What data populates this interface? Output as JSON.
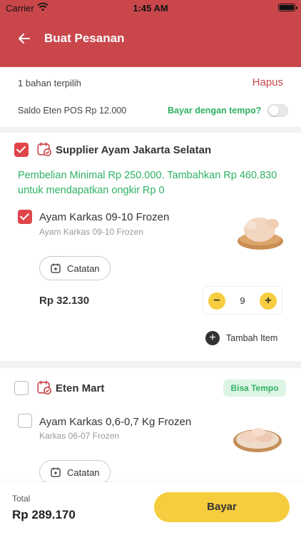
{
  "status_bar": {
    "carrier": "Carrier",
    "time": "1:45 AM"
  },
  "header": {
    "title": "Buat Pesanan",
    "back_icon": "arrow-left-icon",
    "background_color": "#c9474b"
  },
  "summary": {
    "selected_count": "1 bahan terpilih",
    "delete_label": "Hapus",
    "balance": "Saldo Eten POS Rp 12.000",
    "tempo_label": "Bayar dengan tempo?",
    "tempo_enabled": false
  },
  "suppliers": [
    {
      "name": "Supplier Ayam Jakarta Selatan",
      "checked": true,
      "min_purchase_note": "Pembelian Minimal Rp 250.000. Tambahkan Rp 460.830 untuk mendapatkan ongkir Rp 0",
      "items": [
        {
          "name": "Ayam Karkas 09-10 Frozen",
          "subtitle": "Ayam Karkas 09-10 Frozen",
          "checked": true,
          "note_label": "Catatan",
          "price": "Rp 32.130",
          "quantity": "9"
        }
      ],
      "add_item_label": "Tambah Item"
    },
    {
      "name": "Eten Mart",
      "checked": false,
      "badge": "Bisa Tempo",
      "items": [
        {
          "name": "Ayam Karkas 0,6-0,7 Kg Frozen",
          "subtitle": "Karkas 06-07 Frozen",
          "checked": false,
          "note_label": "Catatan"
        }
      ]
    }
  ],
  "footer": {
    "total_label": "Total",
    "total_value": "Rp 289.170",
    "pay_label": "Bayar"
  },
  "colors": {
    "accent_red": "#c9474b",
    "checkbox_red": "#e0454b",
    "green": "#2fb163",
    "yellow": "#f6cd3e"
  }
}
